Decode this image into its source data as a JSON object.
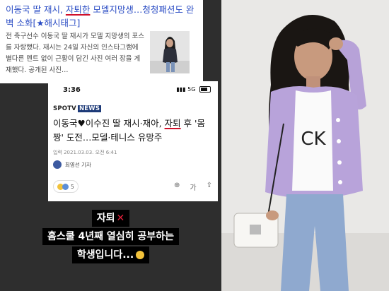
{
  "top_article": {
    "headline_pre": "이동국 딸 재시, ",
    "headline_highlight": "자퇴한",
    "headline_post": " 모델지망생…청청패션도 완벽 소화[★해시태그]",
    "excerpt": "전 축구선수 이동국 딸 재시가 모델 지망생의 포스를 자랑했다. 재시는 24일 자신의 인스타그램에 별다른 멘트 없이 근황이 담긴 사진 여러 장을 게재했다. 공개된 사진…"
  },
  "phone": {
    "time": "3:36",
    "status": "5G",
    "brand_spo": "SPO",
    "brand_tv": "TV",
    "brand_news": "NEWS",
    "title_pre": "이동국♥이수진 딸 재시·재아, ",
    "title_highlight": "자퇴",
    "title_post": " 후 '몸짱' 도전…모델·테니스 유망주",
    "date": "입력 2021.03.03. 오전 6:41",
    "reporter": "최영선 기자",
    "reactions_count": "5"
  },
  "caption": {
    "line1": "자퇴",
    "line1_mark": "✕",
    "line2": "홈스쿨 4년째 열심히 공부하는",
    "line3": "학생입니다..."
  }
}
